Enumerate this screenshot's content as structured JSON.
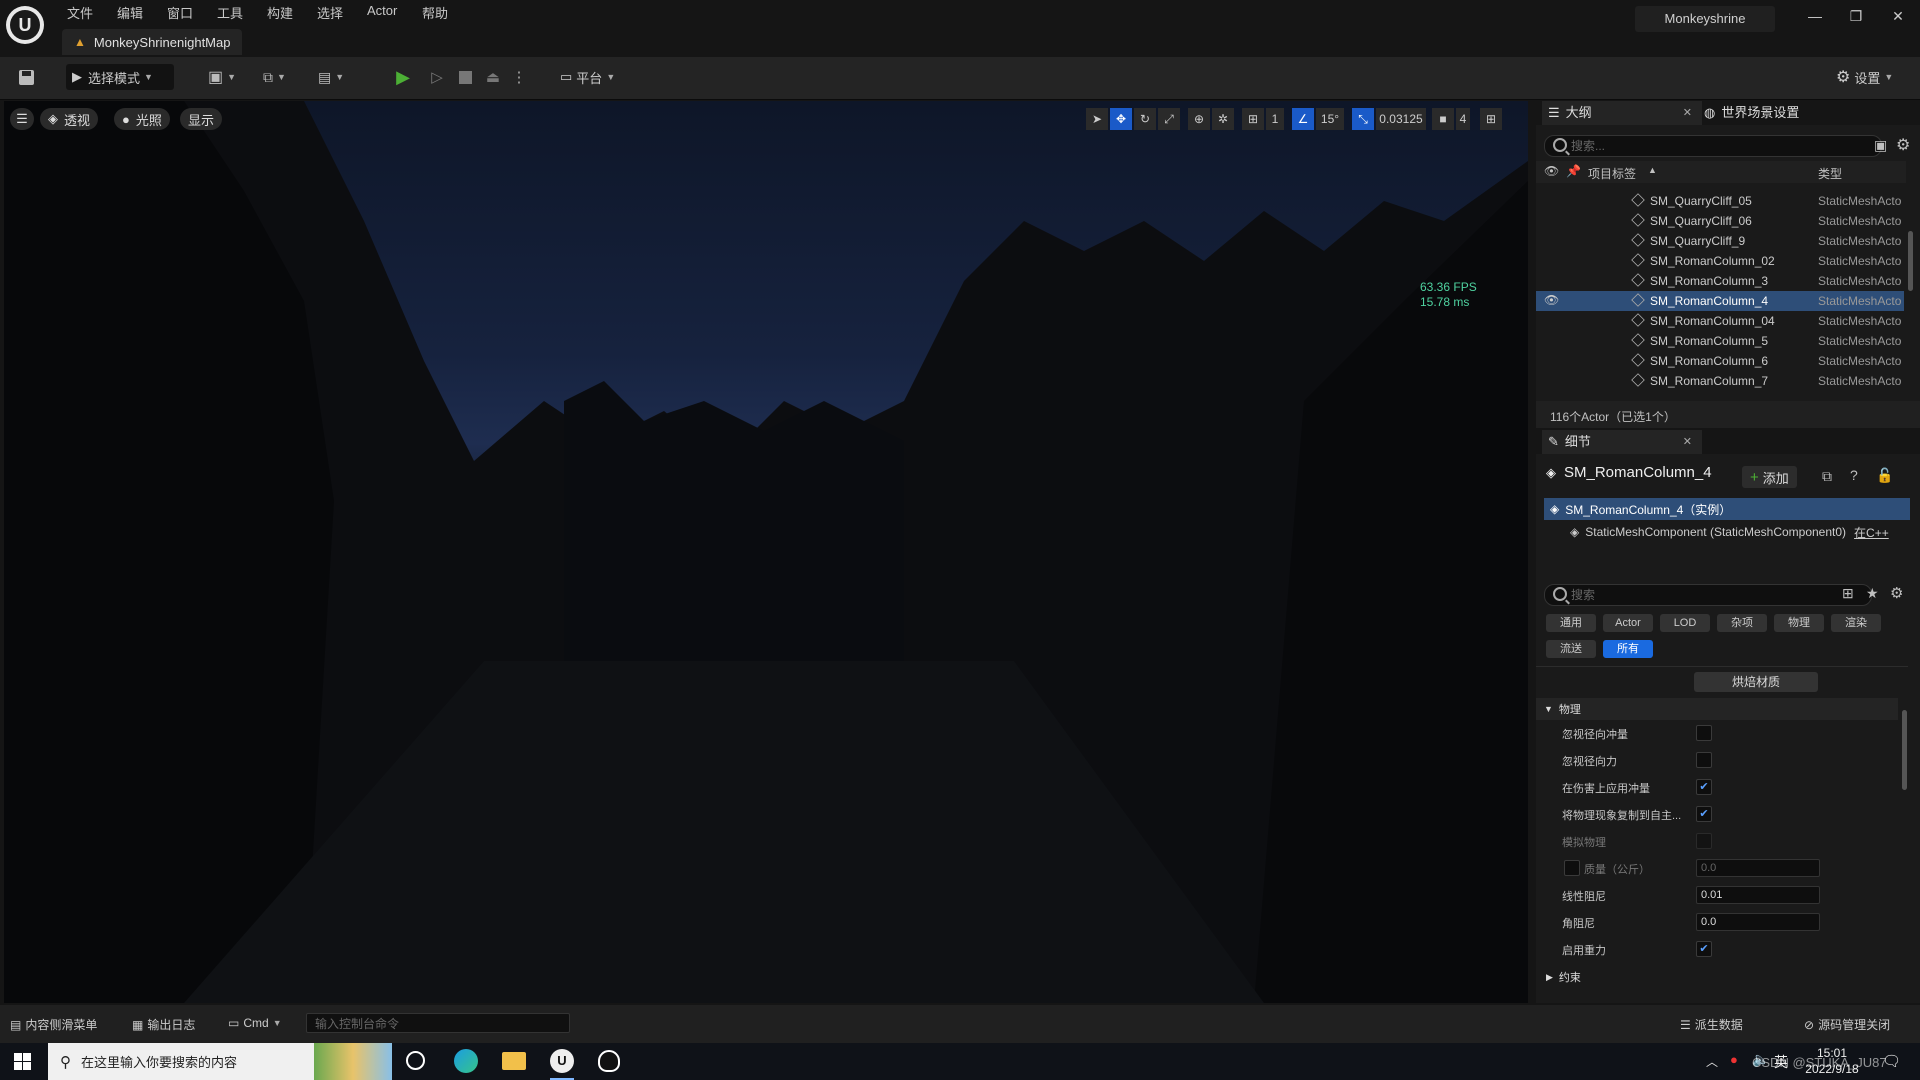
{
  "colors": {
    "accent": "#1a6ae0",
    "selection": "#2e4e78",
    "fps": "#4fd2a0",
    "play": "#4caf35"
  },
  "menu": [
    "文件",
    "编辑",
    "窗口",
    "工具",
    "构建",
    "选择",
    "Actor",
    "帮助"
  ],
  "window": {
    "title": "Monkeyshrine",
    "map_tab": "MonkeyShrinenightMap",
    "minimize": "—",
    "maximize": "❐",
    "close": "✕"
  },
  "toolbar": {
    "select_mode": "选择模式",
    "platform": "平台",
    "settings": "设置"
  },
  "viewport": {
    "perspective": "透视",
    "lighting": "光照",
    "show": "显示",
    "grid_value": "1",
    "angle_value": "15°",
    "scale_value": "0.03125",
    "camera_speed": "4",
    "fps": "63.36 FPS",
    "ms": "15.78 ms"
  },
  "outliner": {
    "tab": "大纲",
    "tab2": "世界场景设置",
    "search_placeholder": "搜索...",
    "col_label": "项目标签",
    "col_type": "类型",
    "rows": [
      {
        "name": "SM_QuarryCliff_05",
        "type": "StaticMeshActor"
      },
      {
        "name": "SM_QuarryCliff_06",
        "type": "StaticMeshActor"
      },
      {
        "name": "SM_QuarryCliff_9",
        "type": "StaticMeshActor"
      },
      {
        "name": "SM_RomanColumn_02",
        "type": "StaticMeshActor"
      },
      {
        "name": "SM_RomanColumn_3",
        "type": "StaticMeshActor"
      },
      {
        "name": "SM_RomanColumn_4",
        "type": "StaticMeshActor"
      },
      {
        "name": "SM_RomanColumn_04",
        "type": "StaticMeshActor"
      },
      {
        "name": "SM_RomanColumn_5",
        "type": "StaticMeshActor"
      },
      {
        "name": "SM_RomanColumn_6",
        "type": "StaticMeshActor"
      },
      {
        "name": "SM_RomanColumn_7",
        "type": "StaticMeshActor"
      }
    ],
    "footer": "116个Actor（已选1个）"
  },
  "details": {
    "tab": "细节",
    "title": "SM_RomanColumn_4",
    "add": "添加",
    "instance": "SM_RomanColumn_4（实例）",
    "component": "StaticMeshComponent (StaticMeshComponent0)",
    "component_link": "在C++",
    "search_placeholder": "搜索",
    "filters": [
      "通用",
      "Actor",
      "LOD",
      "杂项",
      "物理",
      "渲染"
    ],
    "filters2": [
      "流送",
      "所有"
    ],
    "bake_button": "烘焙材质",
    "section": "物理",
    "props": [
      {
        "label": "忽视径向冲量",
        "checked": ""
      },
      {
        "label": "忽视径向力",
        "checked": ""
      },
      {
        "label": "在伤害上应用冲量",
        "checked": "✔"
      },
      {
        "label": "将物理现象复制到自主...",
        "checked": "✔"
      },
      {
        "label": "模拟物理",
        "checked": ""
      }
    ],
    "mass_label": "质量（公斤）",
    "mass_value": "0.0",
    "linear_damping_label": "线性阻尼",
    "linear_damping_value": "0.01",
    "angular_damping_label": "角阻尼",
    "angular_damping_value": "0.0",
    "gravity_label": "启用重力",
    "gravity_checked": "✔",
    "constraints": "约束"
  },
  "statusbar": {
    "content_drawer": "内容侧滑菜单",
    "output_log": "输出日志",
    "cmd": "Cmd",
    "console_placeholder": "输入控制台命令",
    "derived_data": "派生数据",
    "source_control": "源码管理关闭"
  },
  "taskbar": {
    "search_placeholder": "在这里输入你要搜索的内容",
    "ime": "英",
    "time": "15:01",
    "date": "2022/9/18",
    "watermark": "CSDN @STUKA_JU87"
  }
}
